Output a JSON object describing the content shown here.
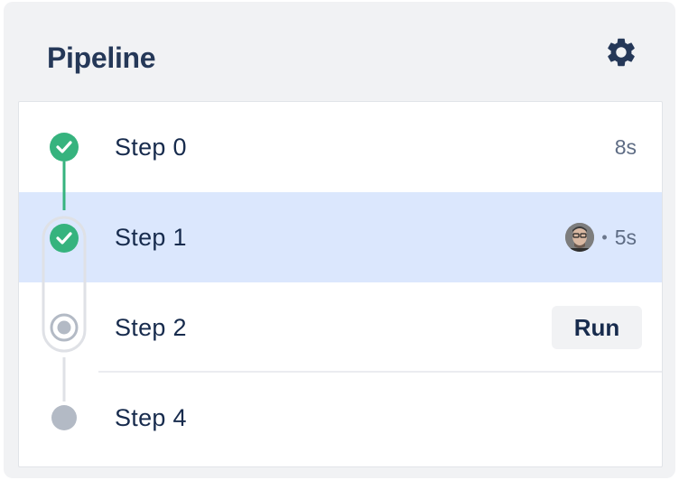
{
  "header": {
    "title": "Pipeline",
    "settings_icon": "gear-icon"
  },
  "colors": {
    "success": "#36b37e",
    "selected_row": "#dbe7fd",
    "pending": "#b3bac5",
    "text": "#172b4d"
  },
  "steps": [
    {
      "label": "Step 0",
      "status": "success",
      "duration": "8s"
    },
    {
      "label": "Step 1",
      "status": "success",
      "duration": "5s",
      "has_avatar": true,
      "selected": true
    },
    {
      "label": "Step 2",
      "status": "current",
      "action_label": "Run"
    },
    {
      "label": "Step 4",
      "status": "pending"
    }
  ],
  "meta_separator": "•"
}
